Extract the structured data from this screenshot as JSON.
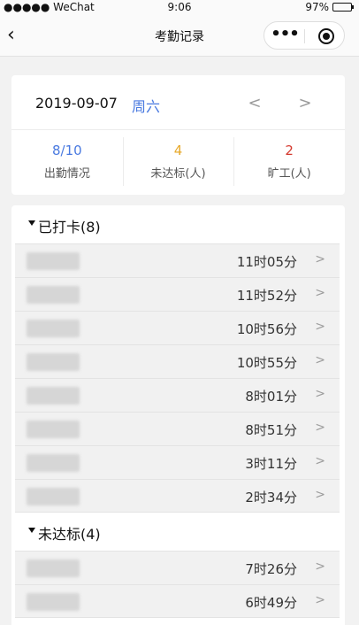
{
  "status_bar": {
    "carrier": "●●●●● WeChat",
    "wifi_icon": "wifi-icon",
    "time": "9:06",
    "battery": "97%",
    "battery_level": 0.97
  },
  "nav": {
    "back_icon": "‹",
    "title": "考勤记录",
    "more_icon": "•••"
  },
  "date_header": {
    "date": "2019-09-07",
    "weekday": "周六",
    "prev": "<",
    "next": ">"
  },
  "stats": [
    {
      "value": "8/10",
      "label": "出勤情况",
      "color": "#4a7ae0"
    },
    {
      "value": "4",
      "label": "未达标(人)",
      "color": "#e7a92a"
    },
    {
      "value": "2",
      "label": "旷工(人)",
      "color": "#d43a2f"
    }
  ],
  "sections": [
    {
      "title": "已打卡(8)",
      "rows": [
        {
          "duration": "11时05分",
          "chevron": ">"
        },
        {
          "duration": "11时52分",
          "chevron": ">"
        },
        {
          "duration": "10时56分",
          "chevron": ">"
        },
        {
          "duration": "10时55分",
          "chevron": ">"
        },
        {
          "duration": "8时01分",
          "chevron": ">"
        },
        {
          "duration": "8时51分",
          "chevron": ">"
        },
        {
          "duration": "3时11分",
          "chevron": ">"
        },
        {
          "duration": "2时34分",
          "chevron": ">"
        }
      ]
    },
    {
      "title": "未达标(4)",
      "rows": [
        {
          "duration": "7时26分",
          "chevron": ">"
        },
        {
          "duration": "6时49分",
          "chevron": ">"
        }
      ]
    }
  ]
}
